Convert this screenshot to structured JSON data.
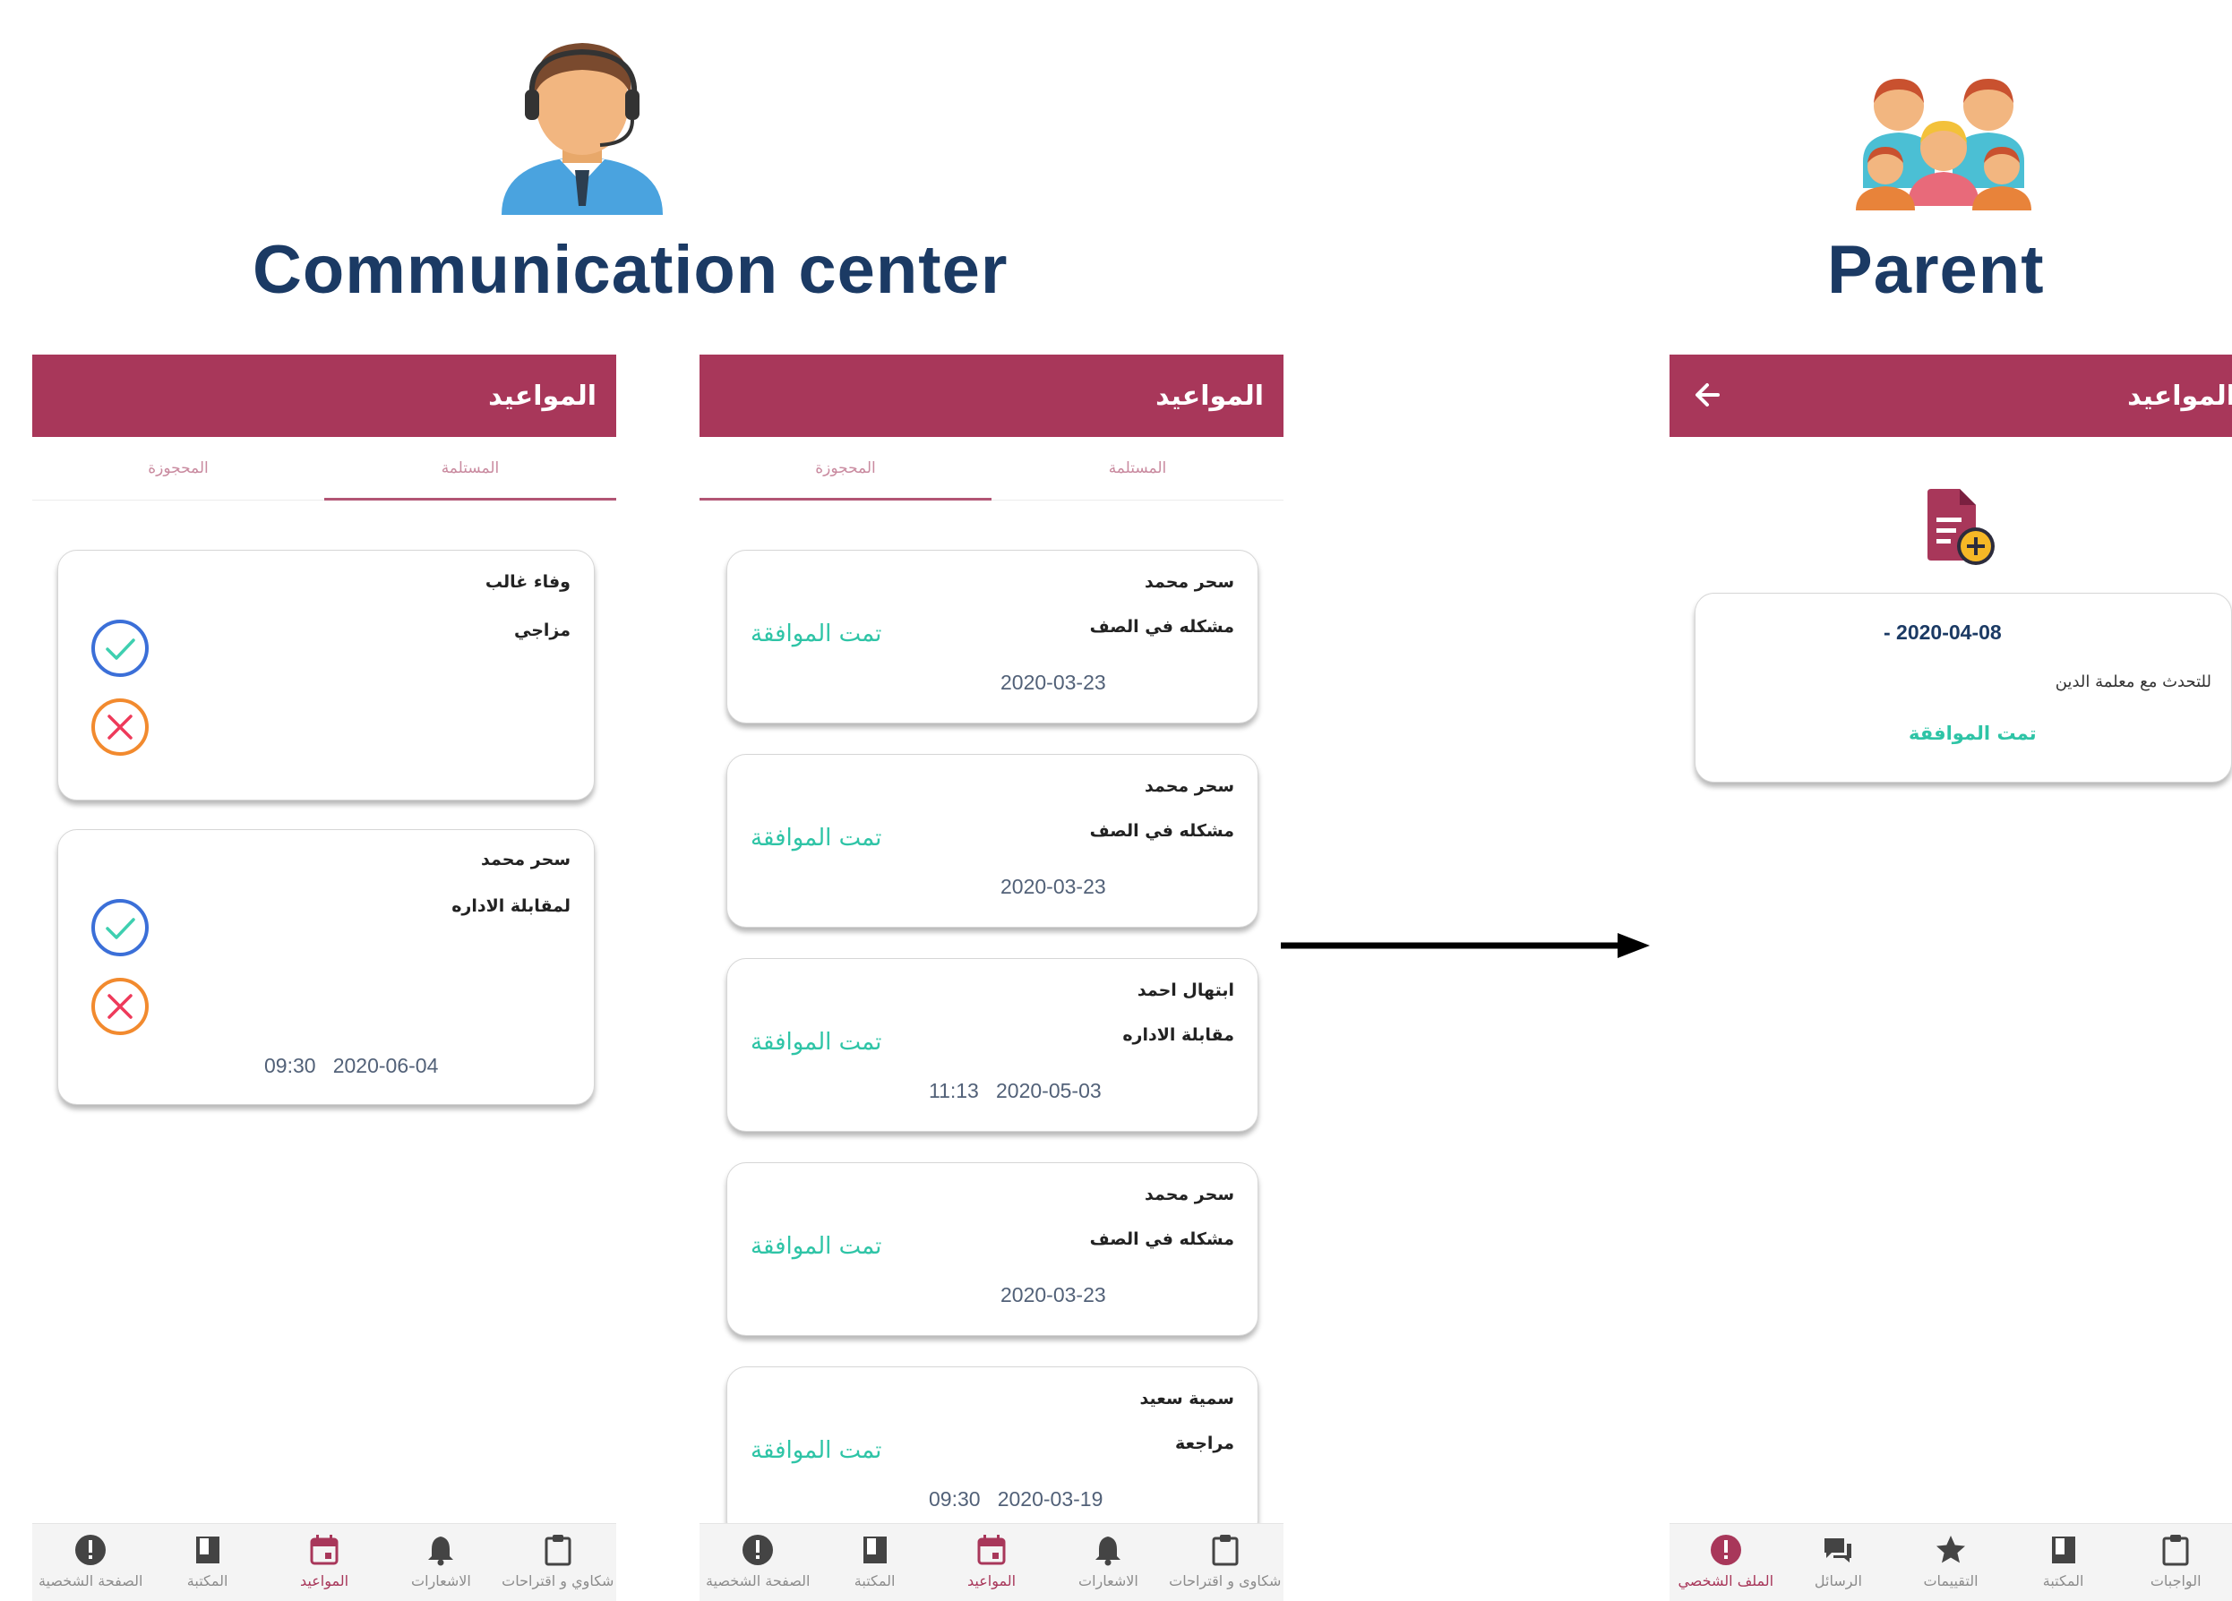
{
  "left_heading": "Communication center",
  "right_heading": "Parent",
  "phone1": {
    "title": "المواعيد",
    "tabs": [
      "المحجوزة",
      "المستلمة"
    ],
    "active_tab": 1,
    "cards": [
      {
        "name": "وفاء غالب",
        "reason": "مزاجي",
        "datetime": ""
      },
      {
        "name": "سحر محمد",
        "reason": "لمقابلة الاداره",
        "datetime": "09:30   2020-06-04"
      }
    ],
    "nav": [
      "الصفحة الشخصية",
      "المكتبة",
      "المواعيد",
      "الاشعارات",
      "شكاوي و اقتراحات"
    ]
  },
  "phone2": {
    "title": "المواعيد",
    "tabs": [
      "المحجوزة",
      "المستلمة"
    ],
    "active_tab": 0,
    "status": "تمت الموافقة",
    "cards": [
      {
        "name": "سحر محمد",
        "reason": "مشكله في الصف",
        "datetime": "2020-03-23"
      },
      {
        "name": "سحر محمد",
        "reason": "مشكله في الصف",
        "datetime": "2020-03-23"
      },
      {
        "name": "ابتهال احمد",
        "reason": "مقابلة الاداره",
        "datetime": "11:13   2020-05-03"
      },
      {
        "name": "سحر محمد",
        "reason": "مشكله في الصف",
        "datetime": "2020-03-23"
      },
      {
        "name": "سمية سعيد",
        "reason": "مراجعة",
        "datetime": "09:30   2020-03-19"
      }
    ],
    "nav": [
      "الصفحة الشخصية",
      "المكتبة",
      "المواعيد",
      "الاشعارات",
      "شكاوى و اقتراحات"
    ]
  },
  "phone3": {
    "title": "المواعيد",
    "card": {
      "date": "- 2020-04-08",
      "reason": "للتحدث مع معلمة الدين",
      "status": "تمت الموافقة"
    },
    "nav": [
      "الملف الشخصي",
      "الرسائل",
      "التقييمات",
      "المكتبة",
      "الواجبات"
    ]
  },
  "colors": {
    "accent": "#a8375a",
    "approved": "#2ec4a6",
    "heading": "#1b3a64",
    "check": "#3b6fd8",
    "cross": "#ee5a3a"
  },
  "icons": {
    "persona_left": "call-center-agent-icon",
    "persona_right": "family-group-icon",
    "add_document": "add-document-icon",
    "back": "back-arrow-icon"
  }
}
